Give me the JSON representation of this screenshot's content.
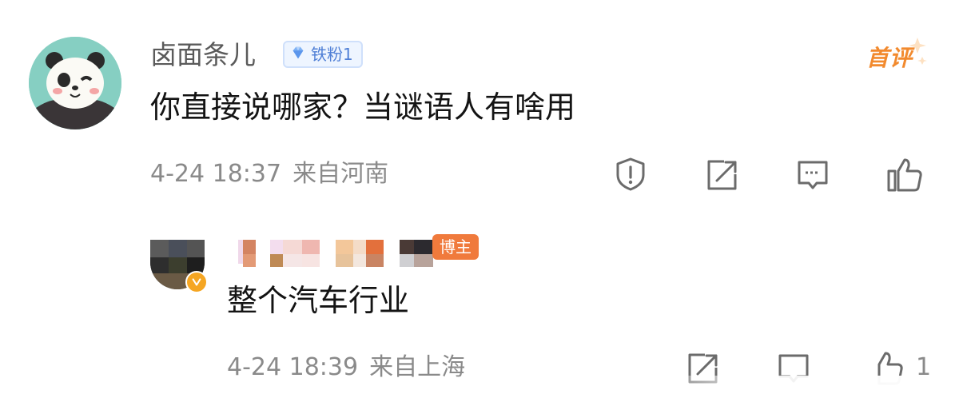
{
  "comment": {
    "username": "卤面条儿",
    "badge_label": "铁粉1",
    "first_comment_tag": "首评",
    "text": "你直接说哪家？当谜语人有啥用",
    "timestamp": "4-24 18:37",
    "location": "来自河南",
    "actions": [
      "report-icon",
      "share-icon",
      "comment-icon",
      "like-icon"
    ]
  },
  "reply": {
    "author_badge": "博主",
    "text": "整个汽车行业",
    "timestamp": "4-24 18:39",
    "location": "来自上海",
    "like_count": "1",
    "actions": [
      "share-icon",
      "comment-icon",
      "like-icon"
    ]
  },
  "colors": {
    "username": "#5a5a5a",
    "meta": "#8a8a8a",
    "badge_text": "#4f7fd6",
    "first_comment": "#f28a2e",
    "host_badge": "#f07a3c"
  }
}
